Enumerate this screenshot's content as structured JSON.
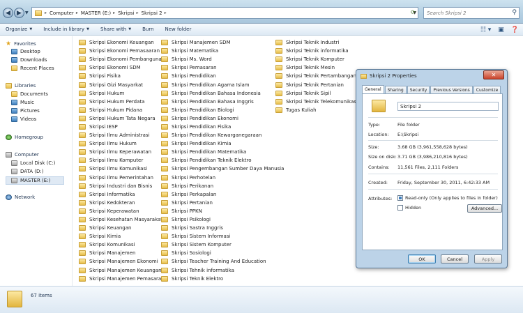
{
  "address": {
    "crumbs": [
      "Computer",
      "MASTER (E:)",
      "Skripsi",
      "Skripsi 2"
    ],
    "search_placeholder": "Search Skripsi 2"
  },
  "toolbar": {
    "organize": "Organize",
    "include": "Include in library",
    "share": "Share with",
    "burn": "Burn",
    "newfolder": "New folder"
  },
  "nav": {
    "favorites": "Favorites",
    "fav_items": [
      "Desktop",
      "Downloads",
      "Recent Places"
    ],
    "libraries": "Libraries",
    "lib_items": [
      "Documents",
      "Music",
      "Pictures",
      "Videos"
    ],
    "homegroup": "Homegroup",
    "computer": "Computer",
    "comp_items": [
      "Local Disk (C:)",
      "DATA (D:)",
      "MASTER (E:)"
    ],
    "network": "Network"
  },
  "files": {
    "col1": [
      "Skripsi Ekonomi Keuangan",
      "Skripsi Ekonomi Pemasaaran",
      "Skripsi Ekonomi Pembangunan",
      "Skripsi Ekonomi SDM",
      "Skripsi Fisika",
      "Skripsi Gizi Masyarkat",
      "Skripsi Hukum",
      "Skripsi Hukum Perdata",
      "Skripsi Hukum Pidana",
      "Skripsi Hukum Tata Negara",
      "Skripsi IESP",
      "Skripsi Ilmu Administrasi",
      "Skripsi Ilmu Hukum",
      "Skripsi Ilmu Keperawatan",
      "Skripsi Ilmu Komputer",
      "Skripsi Ilmu Komunikasi",
      "Skripsi Ilmu Pemerintahan",
      "Skripsi Industri dan Bisnis",
      "Skripsi Informatika",
      "Skripsi Kedokteran",
      "Skripsi Keperawatan",
      "Skripsi Kesehatan Masyarakat",
      "Skripsi Keuangan",
      "Skripsi Kimia",
      "Skripsi Komunikasi",
      "Skripsi Manajemen",
      "Skripsi Manajemen Ekonomi",
      "Skripsi Manajemen Keuangan",
      "Skripsi Manajemen Pemasaran"
    ],
    "col2": [
      "Skripsi Manajemen SDM",
      "Skripsi Matematika",
      "Skripsi Ms. Word",
      "Skripsi Pemasaran",
      "Skripsi Pendidikan",
      "Skripsi Pendidikan Agama Islam",
      "Skripsi Pendidikan Bahasa Indonesia",
      "Skripsi Pendidikan Bahasa Inggris",
      "Skripsi Pendidikan Biologi",
      "Skripsi Pendidikan Ekonomi",
      "Skripsi Pendidikan Fisika",
      "Skripsi Pendidikan Kewarganegaraan",
      "Skripsi Pendidikan Kimia",
      "Skripsi Pendidikan Matematika",
      "Skripsi Pendidikan Teknik Elektro",
      "Skripsi Pengembangan Sumber Daya Manusia",
      "Skripsi Perhotelan",
      "Skripsi Perikanan",
      "Skripsi Perkapalan",
      "Skripsi Pertanian",
      "Skripsi PPKN",
      "Skripsi Psikologi",
      "Skripsi Sastra Inggris",
      "Skripsi Sistem Informasi",
      "Skripsi Sistem Komputer",
      "Skripsi Sosiologi",
      "Skripsi Teacher Training And Education",
      "Skripsi Tehnik informatika",
      "Skripsi Teknik Elektro"
    ],
    "col3": [
      "Skripsi Teknik Industri",
      "Skripsi Teknik informatika",
      "Skripsi Teknik Komputer",
      "Skripsi Teknik Mesin",
      "Skripsi Teknik Pertambangan",
      "Skripsi Teknik Pertanian",
      "Skripsi Teknik Sipil",
      "Skripsi Teknik Telekomunikasi",
      "Tugas Kuliah"
    ]
  },
  "status": {
    "count": "67 items"
  },
  "dialog": {
    "title": "Skripsi 2 Properties",
    "tabs": [
      "General",
      "Sharing",
      "Security",
      "Previous Versions",
      "Customize"
    ],
    "name": "Skripsi 2",
    "rows": [
      {
        "label": "Type:",
        "value": "File folder"
      },
      {
        "label": "Location:",
        "value": "E:\\Skripsi"
      },
      {
        "label": "Size:",
        "value": "3.68 GB (3,961,558,628 bytes)"
      },
      {
        "label": "Size on disk:",
        "value": "3.71 GB (3,986,210,816 bytes)"
      },
      {
        "label": "Contains:",
        "value": "11,561 Files, 2,111 Folders"
      },
      {
        "label": "Created:",
        "value": "Friday, September 30, 2011, 6:42:33 AM"
      }
    ],
    "attributes_label": "Attributes:",
    "readonly": "Read-only (Only applies to files in folder)",
    "hidden": "Hidden",
    "advanced": "Advanced...",
    "ok": "OK",
    "cancel": "Cancel",
    "apply": "Apply",
    "close": "✕"
  }
}
